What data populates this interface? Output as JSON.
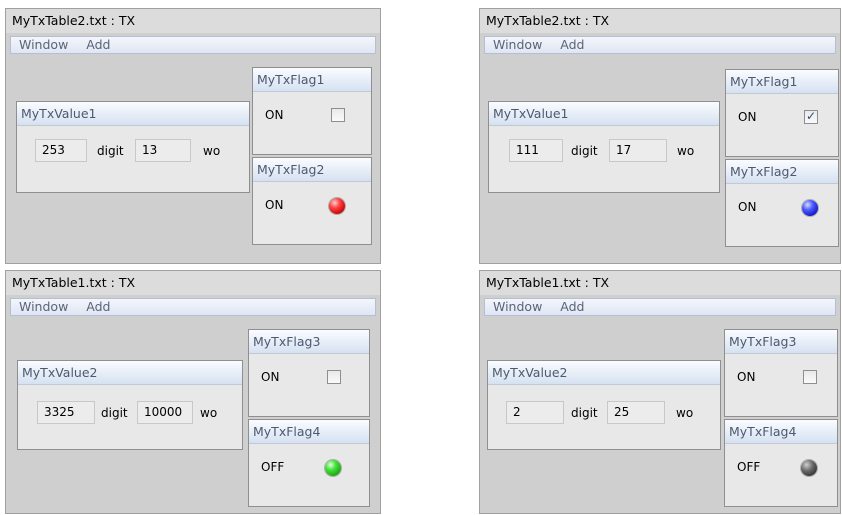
{
  "windows": [
    {
      "title": "MyTxTable2.txt : TX",
      "menu": [
        "Window",
        "Add"
      ],
      "value_panel": {
        "name": "MyTxValue1",
        "value": "253",
        "unit": "digit",
        "value2": "13",
        "unit2": "wo"
      },
      "flag_panels": [
        {
          "name": "MyTxFlag1",
          "state": "ON",
          "kind": "checkbox",
          "checked": false
        },
        {
          "name": "MyTxFlag2",
          "state": "ON",
          "kind": "led",
          "color": "#e82020"
        }
      ]
    },
    {
      "title": "MyTxTable2.txt : TX",
      "menu": [
        "Window",
        "Add"
      ],
      "value_panel": {
        "name": "MyTxValue1",
        "value": "111",
        "unit": "digit",
        "value2": "17",
        "unit2": "wo"
      },
      "flag_panels": [
        {
          "name": "MyTxFlag1",
          "state": "ON",
          "kind": "checkbox",
          "checked": true
        },
        {
          "name": "MyTxFlag2",
          "state": "ON",
          "kind": "led",
          "color": "#2a3ae8"
        }
      ]
    },
    {
      "title": "MyTxTable1.txt : TX",
      "menu": [
        "Window",
        "Add"
      ],
      "value_panel": {
        "name": "MyTxValue2",
        "value": "3325",
        "unit": "digit",
        "value2": "10000",
        "unit2": "wo"
      },
      "flag_panels": [
        {
          "name": "MyTxFlag3",
          "state": "ON",
          "kind": "checkbox",
          "checked": false
        },
        {
          "name": "MyTxFlag4",
          "state": "OFF",
          "kind": "led",
          "color": "#2fd12a"
        }
      ]
    },
    {
      "title": "MyTxTable1.txt : TX",
      "menu": [
        "Window",
        "Add"
      ],
      "value_panel": {
        "name": "MyTxValue2",
        "value": "2",
        "unit": "digit",
        "value2": "25",
        "unit2": "wo"
      },
      "flag_panels": [
        {
          "name": "MyTxFlag3",
          "state": "ON",
          "kind": "checkbox",
          "checked": false
        },
        {
          "name": "MyTxFlag4",
          "state": "OFF",
          "kind": "led",
          "color": "#4a4a4a"
        }
      ]
    }
  ],
  "icons": {
    "checkbox_tick": "✓"
  }
}
